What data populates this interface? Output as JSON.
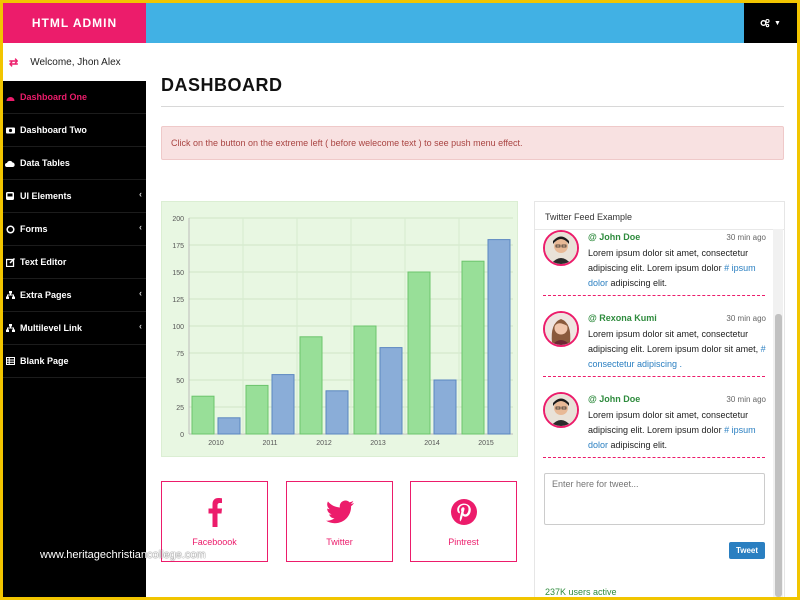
{
  "brand": {
    "title": "HTML ADMIN"
  },
  "header": {
    "settings_icon": "cogs-icon"
  },
  "welcome": {
    "text": "Welcome, Jhon Alex",
    "toggle_icon": "exchange-icon"
  },
  "sidebar": {
    "items": [
      {
        "label": "Dashboard One",
        "icon": "dashboard-icon",
        "active": true,
        "submenu": false
      },
      {
        "label": "Dashboard Two",
        "icon": "camera-icon",
        "active": false,
        "submenu": false
      },
      {
        "label": "Data Tables",
        "icon": "cloud-icon",
        "active": false,
        "submenu": false
      },
      {
        "label": "UI Elements",
        "icon": "bus-icon",
        "active": false,
        "submenu": true
      },
      {
        "label": "Forms",
        "icon": "circle-icon",
        "active": false,
        "submenu": true
      },
      {
        "label": "Text Editor",
        "icon": "edit-icon",
        "active": false,
        "submenu": false
      },
      {
        "label": "Extra Pages",
        "icon": "sitemap-icon",
        "active": false,
        "submenu": true
      },
      {
        "label": "Multilevel Link",
        "icon": "sitemap-icon",
        "active": false,
        "submenu": true
      },
      {
        "label": "Blank Page",
        "icon": "table-icon",
        "active": false,
        "submenu": false
      }
    ]
  },
  "main": {
    "title": "DASHBOARD",
    "alert": "Click on the button on the extreme left ( before welecome text ) to see push menu effect."
  },
  "chart_data": {
    "type": "bar",
    "categories": [
      "2010",
      "2011",
      "2012",
      "2013",
      "2014",
      "2015"
    ],
    "series": [
      {
        "values": [
          35,
          45,
          90,
          100,
          150,
          160
        ],
        "color": "#98df98"
      },
      {
        "values": [
          15,
          55,
          40,
          80,
          50,
          180
        ],
        "color": "#8aadd8"
      }
    ],
    "ylim": [
      0,
      200
    ],
    "yticks": [
      0,
      25,
      50,
      75,
      100,
      125,
      150,
      175,
      200
    ],
    "grid": true
  },
  "social": [
    {
      "label": "Faceboook",
      "icon": "facebook-icon"
    },
    {
      "label": "Twitter",
      "icon": "twitter-icon"
    },
    {
      "label": "Pintrest",
      "icon": "pinterest-icon"
    }
  ],
  "twitter": {
    "title": "Twitter Feed Example",
    "tweets": [
      {
        "name": "@ John Doe",
        "time": "30 min ago",
        "text": "Lorem ipsum dolor sit amet, consectetur adipiscing elit. Lorem ipsum dolor",
        "tag": "# ipsum dolor",
        "after": " adipiscing elit."
      },
      {
        "name": "@ Rexona Kumi",
        "time": "30 min ago",
        "text": "Lorem ipsum dolor sit amet, consectetur adipiscing elit. Lorem ipsum dolor sit amet,",
        "tag": "# consectetur adipiscing .",
        "after": ""
      },
      {
        "name": "@ John Doe",
        "time": "30 min ago",
        "text": "Lorem ipsum dolor sit amet, consectetur adipiscing elit. Lorem ipsum dolor",
        "tag": "# ipsum dolor",
        "after": " adipiscing elit."
      }
    ],
    "input_placeholder": "Enter here for tweet...",
    "button": "Tweet",
    "footer": "237K users active"
  },
  "watermark": "www.heritagechristiancollege.com"
}
